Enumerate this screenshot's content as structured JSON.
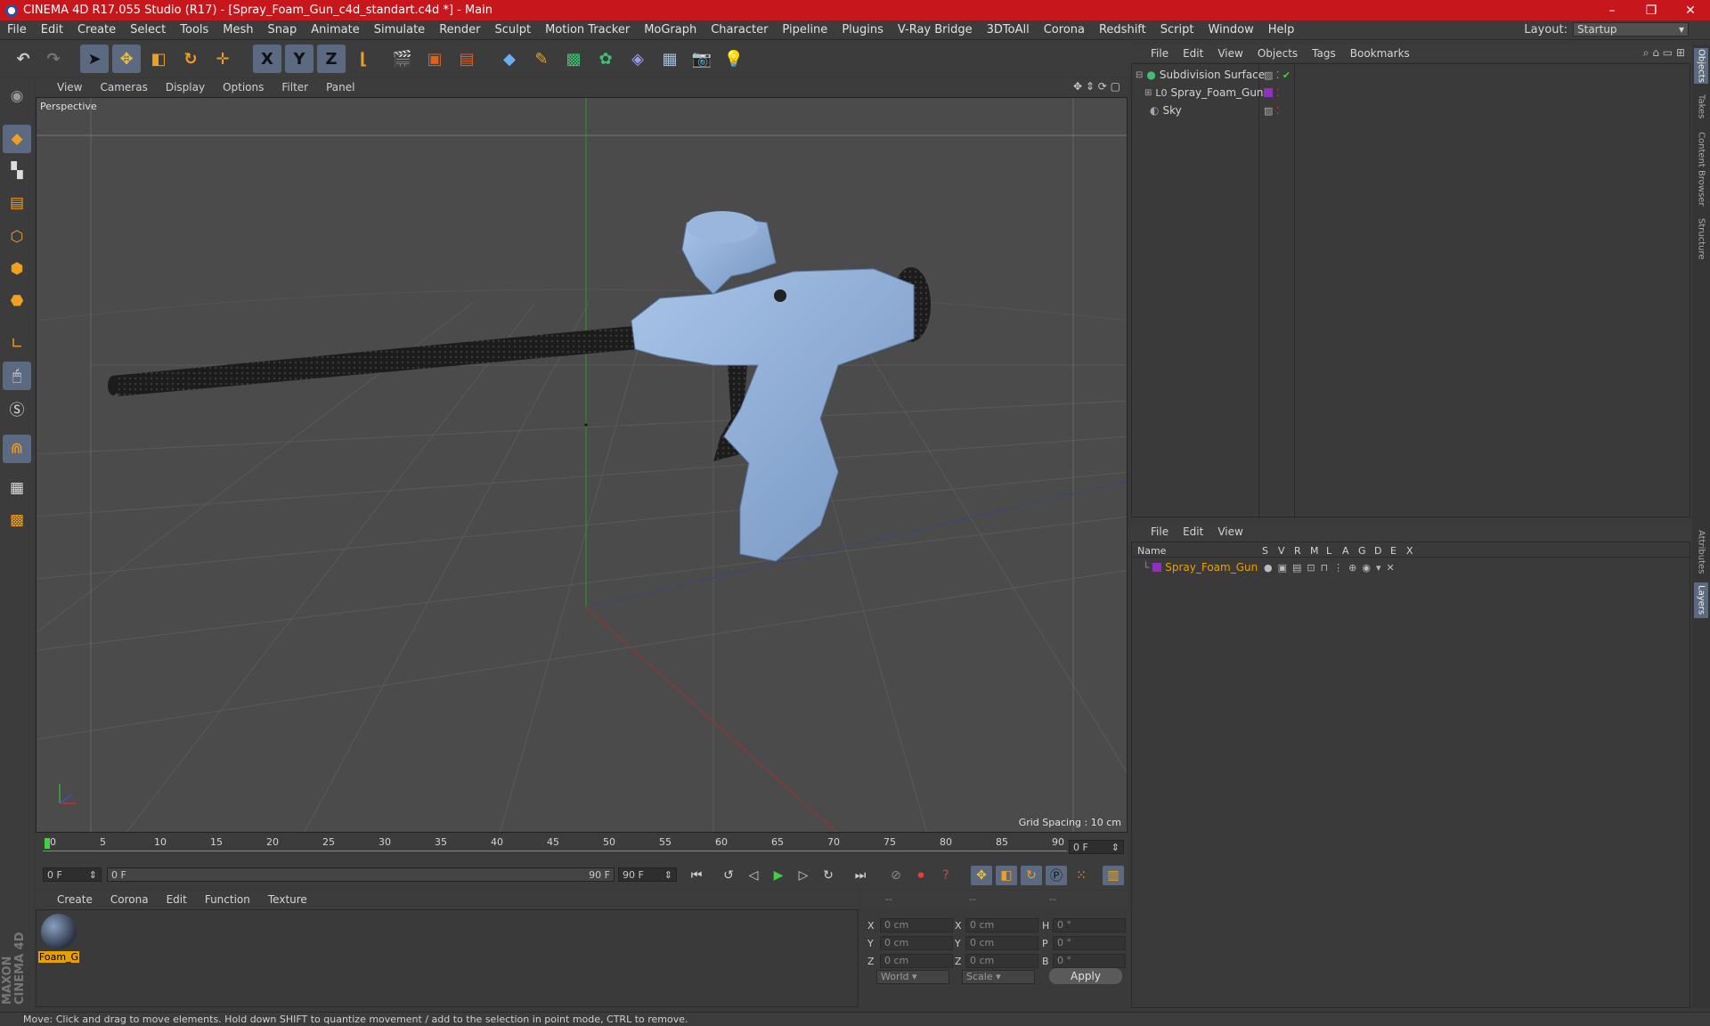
{
  "window": {
    "title": "CINEMA 4D R17.055 Studio (R17) - [Spray_Foam_Gun_c4d_standart.c4d *] - Main",
    "controls": [
      "–",
      "❐",
      "✕"
    ]
  },
  "menubar": {
    "items": [
      "File",
      "Edit",
      "Create",
      "Select",
      "Tools",
      "Mesh",
      "Snap",
      "Animate",
      "Simulate",
      "Render",
      "Sculpt",
      "Motion Tracker",
      "MoGraph",
      "Character",
      "Pipeline",
      "Plugins",
      "V-Ray Bridge",
      "3DToAll",
      "Corona",
      "Redshift",
      "Script",
      "Window",
      "Help"
    ],
    "layout_label": "Layout:",
    "layout_value": "Startup"
  },
  "toolbar": {
    "axis_x": "X",
    "axis_y": "Y",
    "axis_z": "Z"
  },
  "viewport": {
    "menu": [
      "View",
      "Cameras",
      "Display",
      "Options",
      "Filter",
      "Panel"
    ],
    "label": "Perspective",
    "grid_spacing": "Grid Spacing : 10 cm"
  },
  "timeline": {
    "ticks": [
      "0",
      "5",
      "10",
      "15",
      "20",
      "25",
      "30",
      "35",
      "40",
      "45",
      "50",
      "55",
      "60",
      "65",
      "70",
      "75",
      "80",
      "85",
      "90"
    ],
    "current_frame": "0 F",
    "start_frame": "0 F",
    "range_start": "0 F",
    "range_end": "90 F",
    "end_frame": "90 F"
  },
  "material_manager": {
    "menu": [
      "Create",
      "Corona",
      "Edit",
      "Function",
      "Texture"
    ],
    "materials": [
      {
        "name": "Foam_G"
      }
    ]
  },
  "coordinates": {
    "header": [
      "--",
      "--",
      "--"
    ],
    "rows": [
      {
        "l1": "X",
        "v1": "0 cm",
        "l2": "X",
        "v2": "0 cm",
        "l3": "H",
        "v3": "0 °"
      },
      {
        "l1": "Y",
        "v1": "0 cm",
        "l2": "Y",
        "v2": "0 cm",
        "l3": "P",
        "v3": "0 °"
      },
      {
        "l1": "Z",
        "v1": "0 cm",
        "l2": "Z",
        "v2": "0 cm",
        "l3": "B",
        "v3": "0 °"
      }
    ],
    "mode1": "World",
    "mode2": "Scale",
    "apply": "Apply"
  },
  "object_manager": {
    "menu": [
      "File",
      "Edit",
      "View",
      "Objects",
      "Tags",
      "Bookmarks"
    ],
    "objects": [
      {
        "name": "Subdivision Surface",
        "color": "#d0d0d0"
      },
      {
        "name": "Spray_Foam_Gun",
        "color": "#d0d0d0"
      },
      {
        "name": "Sky",
        "color": "#d0d0d0"
      }
    ]
  },
  "layer_manager": {
    "menu": [
      "File",
      "Edit",
      "View"
    ],
    "columns": [
      "Name",
      "S",
      "V",
      "R",
      "M",
      "L",
      "A",
      "G",
      "D",
      "E",
      "X"
    ],
    "layers": [
      {
        "name": "Spray_Foam_Gun",
        "color": "#e8a000"
      }
    ]
  },
  "side_tabs": [
    "Objects",
    "Takes",
    "Content Browser",
    "Structure",
    "Attributes",
    "Layers"
  ],
  "status": "Move: Click and drag to move elements. Hold down SHIFT to quantize movement / add to the selection in point mode, CTRL to remove.",
  "logo": "MAXON CINEMA 4D",
  "colors": {
    "accent": "#5b6a80",
    "title_bar": "#c8161d",
    "layer_highlight": "#e8a000",
    "gun_body": "#8fb0d8"
  }
}
